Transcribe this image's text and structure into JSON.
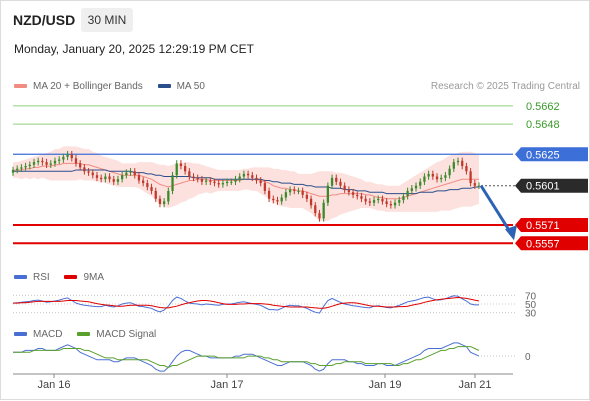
{
  "header": {
    "pair": "NZD/USD",
    "timeframe": "30 MIN",
    "datetime": "Monday, January 20, 2025 12:29:19 PM CET"
  },
  "legend": {
    "ma20_label": "MA 20 + Bollinger Bands",
    "ma50_label": "MA 50",
    "credit": "Research © 2025 Trading Central",
    "rsi_label": "RSI",
    "rsi_ma_label": "9MA",
    "macd_label": "MACD",
    "macd_signal_label": "MACD Signal"
  },
  "colors": {
    "ma20": "#f28b82",
    "bollinger_fill": "#fbd9d6",
    "ma50": "#2b4f8c",
    "resistance_line": "#8fd07a",
    "resistance_text": "#3a9a2a",
    "pivot_line": "#3c6fd8",
    "support_line": "#e00000",
    "bull_candle": "#3a8a2a",
    "bear_candle": "#c0392b",
    "rsi": "#4a6fd4",
    "rsi_ma": "#e00000",
    "macd": "#4a6fd4",
    "macd_signal": "#5aa02c",
    "arrow": "#2d63b5"
  },
  "chart_data": {
    "type": "candlestick",
    "title": "NZD/USD 30 MIN",
    "x_tick_labels": [
      "Jan 16",
      "Jan 17",
      "Jan 19",
      "Jan 21"
    ],
    "price_range": [
      0.5545,
      0.5668
    ],
    "levels": [
      {
        "value": 0.5662,
        "label": "0.5662",
        "kind": "resistance"
      },
      {
        "value": 0.5648,
        "label": "0.5648",
        "kind": "resistance"
      },
      {
        "value": 0.5625,
        "label": "0.5625",
        "kind": "pivot"
      },
      {
        "value": 0.5601,
        "label": "0.5601",
        "kind": "last"
      },
      {
        "value": 0.5571,
        "label": "0.5571",
        "kind": "support"
      },
      {
        "value": 0.5557,
        "label": "0.5557",
        "kind": "support"
      }
    ],
    "last_price": 0.5601,
    "forecast_target": 0.5557,
    "close_series": [
      0.5613,
      0.5614,
      0.5615,
      0.5616,
      0.5617,
      0.5619,
      0.562,
      0.5619,
      0.5617,
      0.5618,
      0.562,
      0.5621,
      0.5623,
      0.5625,
      0.5622,
      0.5618,
      0.5615,
      0.5612,
      0.5611,
      0.5609,
      0.5607,
      0.5606,
      0.5608,
      0.5606,
      0.5604,
      0.5606,
      0.5609,
      0.5611,
      0.5612,
      0.5609,
      0.5605,
      0.5603,
      0.56,
      0.5597,
      0.5591,
      0.5587,
      0.5589,
      0.5597,
      0.5609,
      0.5618,
      0.5616,
      0.5612,
      0.5608,
      0.5607,
      0.5606,
      0.5604,
      0.5605,
      0.5604,
      0.5603,
      0.5602,
      0.5603,
      0.5604,
      0.5604,
      0.5606,
      0.5608,
      0.561,
      0.5609,
      0.5607,
      0.5605,
      0.5603,
      0.5597,
      0.5591,
      0.559,
      0.5589,
      0.5592,
      0.5596,
      0.5598,
      0.5597,
      0.5597,
      0.5594,
      0.5591,
      0.5586,
      0.558,
      0.5576,
      0.5588,
      0.5601,
      0.5607,
      0.5604,
      0.5601,
      0.5598,
      0.5596,
      0.5594,
      0.5593,
      0.5591,
      0.5589,
      0.5588,
      0.559,
      0.5591,
      0.5589,
      0.5587,
      0.5586,
      0.5588,
      0.559,
      0.5593,
      0.5597,
      0.5599,
      0.5601,
      0.5604,
      0.5608,
      0.561,
      0.5608,
      0.5606,
      0.5607,
      0.5609,
      0.5614,
      0.5619,
      0.562,
      0.5616,
      0.5612,
      0.5603,
      0.5601,
      0.5601
    ],
    "ma20_series": [
      0.5613,
      0.5613,
      0.5613,
      0.5614,
      0.5614,
      0.5615,
      0.5615,
      0.5616,
      0.5616,
      0.5616,
      0.5617,
      0.5617,
      0.5618,
      0.5618,
      0.5618,
      0.5618,
      0.5618,
      0.5617,
      0.5617,
      0.5616,
      0.5615,
      0.5614,
      0.5613,
      0.5612,
      0.5611,
      0.561,
      0.5609,
      0.5609,
      0.5609,
      0.5609,
      0.5609,
      0.5608,
      0.5607,
      0.5606,
      0.5604,
      0.5602,
      0.5601,
      0.56,
      0.5601,
      0.5602,
      0.5603,
      0.5604,
      0.5605,
      0.5605,
      0.5606,
      0.5606,
      0.5606,
      0.5605,
      0.5605,
      0.5605,
      0.5605,
      0.5605,
      0.5605,
      0.5605,
      0.5605,
      0.5606,
      0.5606,
      0.5606,
      0.5606,
      0.5605,
      0.5604,
      0.5603,
      0.5601,
      0.56,
      0.5599,
      0.5599,
      0.5598,
      0.5598,
      0.5597,
      0.5597,
      0.5596,
      0.5595,
      0.5594,
      0.5593,
      0.5593,
      0.5593,
      0.5594,
      0.5594,
      0.5595,
      0.5595,
      0.5595,
      0.5595,
      0.5595,
      0.5595,
      0.5594,
      0.5594,
      0.5593,
      0.5592,
      0.5592,
      0.5591,
      0.5591,
      0.5591,
      0.5591,
      0.5592,
      0.5593,
      0.5594,
      0.5595,
      0.5596,
      0.5597,
      0.5598,
      0.5599,
      0.56,
      0.5601,
      0.5602,
      0.5603,
      0.5604,
      0.5605,
      0.5606,
      0.5606,
      0.5606,
      0.5606,
      0.5606
    ],
    "band_half_width": [
      0.0006,
      0.0006,
      0.0007,
      0.0007,
      0.0008,
      0.0008,
      0.0009,
      0.0009,
      0.001,
      0.0011,
      0.0012,
      0.0012,
      0.0013,
      0.0013,
      0.0013,
      0.0013,
      0.0012,
      0.0012,
      0.0012,
      0.0011,
      0.0011,
      0.001,
      0.001,
      0.001,
      0.001,
      0.001,
      0.0009,
      0.0009,
      0.0009,
      0.0009,
      0.001,
      0.0011,
      0.0012,
      0.0013,
      0.0014,
      0.0015,
      0.0016,
      0.0016,
      0.0016,
      0.0016,
      0.0015,
      0.0015,
      0.0014,
      0.0013,
      0.0012,
      0.0011,
      0.001,
      0.001,
      0.0009,
      0.0008,
      0.0008,
      0.0008,
      0.0008,
      0.0008,
      0.0008,
      0.0008,
      0.0008,
      0.0009,
      0.0009,
      0.001,
      0.0011,
      0.0012,
      0.0013,
      0.0014,
      0.0014,
      0.0014,
      0.0014,
      0.0014,
      0.0013,
      0.0013,
      0.0014,
      0.0015,
      0.0017,
      0.0019,
      0.0019,
      0.0019,
      0.0018,
      0.0017,
      0.0016,
      0.0015,
      0.0014,
      0.0013,
      0.0012,
      0.0011,
      0.001,
      0.001,
      0.001,
      0.001,
      0.001,
      0.001,
      0.001,
      0.001,
      0.001,
      0.0011,
      0.0012,
      0.0013,
      0.0014,
      0.0015,
      0.0016,
      0.0017,
      0.0018,
      0.0019,
      0.0019,
      0.002,
      0.0021,
      0.0021,
      0.0021,
      0.0021,
      0.0021,
      0.0021,
      0.002,
      0.0019
    ],
    "ma50_series": [
      0.5612,
      0.5612,
      0.5612,
      0.5612,
      0.5612,
      0.5612,
      0.5612,
      0.5612,
      0.5612,
      0.5612,
      0.5612,
      0.5612,
      0.5612,
      0.5612,
      0.5612,
      0.5613,
      0.5613,
      0.5613,
      0.5613,
      0.5613,
      0.5613,
      0.5613,
      0.5613,
      0.5612,
      0.5612,
      0.5612,
      0.5612,
      0.5612,
      0.5612,
      0.5611,
      0.5611,
      0.5611,
      0.561,
      0.561,
      0.5609,
      0.5609,
      0.5608,
      0.5608,
      0.5608,
      0.5608,
      0.5608,
      0.5608,
      0.5608,
      0.5607,
      0.5607,
      0.5607,
      0.5607,
      0.5607,
      0.5606,
      0.5606,
      0.5606,
      0.5606,
      0.5606,
      0.5606,
      0.5606,
      0.5606,
      0.5606,
      0.5606,
      0.5606,
      0.5606,
      0.5605,
      0.5605,
      0.5604,
      0.5604,
      0.5603,
      0.5603,
      0.5603,
      0.5602,
      0.5602,
      0.5602,
      0.5601,
      0.5601,
      0.56,
      0.56,
      0.56,
      0.56,
      0.5599,
      0.5599,
      0.5599,
      0.5598,
      0.5598,
      0.5598,
      0.5597,
      0.5597,
      0.5597,
      0.5596,
      0.5596,
      0.5596,
      0.5596,
      0.5595,
      0.5595,
      0.5595,
      0.5595,
      0.5595,
      0.5595,
      0.5595,
      0.5595,
      0.5596,
      0.5596,
      0.5596,
      0.5596,
      0.5597,
      0.5597,
      0.5597,
      0.5598,
      0.5598,
      0.5598,
      0.5599,
      0.5599,
      0.5599,
      0.56,
      0.56
    ],
    "rsi": {
      "ticks": [
        70,
        50,
        30
      ],
      "range": [
        20,
        80
      ],
      "values": [
        52,
        53,
        54,
        55,
        56,
        58,
        59,
        57,
        54,
        55,
        57,
        59,
        62,
        64,
        58,
        52,
        49,
        47,
        46,
        45,
        44,
        44,
        47,
        45,
        43,
        46,
        50,
        52,
        53,
        49,
        45,
        44,
        42,
        40,
        35,
        32,
        36,
        45,
        58,
        66,
        63,
        57,
        52,
        51,
        50,
        48,
        50,
        49,
        48,
        47,
        49,
        50,
        50,
        52,
        54,
        55,
        53,
        51,
        49,
        47,
        42,
        37,
        37,
        36,
        40,
        45,
        47,
        46,
        46,
        43,
        40,
        35,
        31,
        29,
        45,
        58,
        63,
        58,
        54,
        50,
        48,
        46,
        45,
        43,
        42,
        41,
        45,
        46,
        44,
        42,
        41,
        44,
        47,
        51,
        55,
        57,
        59,
        62,
        65,
        66,
        62,
        59,
        60,
        62,
        66,
        69,
        68,
        62,
        57,
        50,
        48,
        48
      ],
      "ma_values": [
        52,
        52,
        53,
        53,
        54,
        55,
        56,
        56,
        56,
        56,
        56,
        56,
        57,
        58,
        58,
        58,
        57,
        56,
        55,
        53,
        51,
        49,
        48,
        47,
        46,
        45,
        45,
        46,
        47,
        47,
        47,
        47,
        47,
        46,
        44,
        42,
        41,
        41,
        43,
        45,
        48,
        51,
        53,
        55,
        57,
        58,
        58,
        57,
        55,
        53,
        51,
        49,
        49,
        49,
        50,
        50,
        51,
        51,
        51,
        51,
        50,
        49,
        47,
        46,
        45,
        44,
        43,
        43,
        43,
        43,
        43,
        42,
        41,
        40,
        40,
        42,
        45,
        48,
        51,
        52,
        53,
        53,
        52,
        50,
        48,
        46,
        45,
        45,
        44,
        43,
        43,
        43,
        44,
        44,
        45,
        47,
        49,
        51,
        54,
        56,
        58,
        60,
        61,
        62,
        63,
        64,
        65,
        64,
        63,
        61,
        59,
        57
      ]
    },
    "macd": {
      "ticks": [
        0
      ],
      "range": [
        -0.0009,
        0.0008
      ],
      "macd_values": [
        0.0002,
        0.0002,
        0.0002,
        0.0003,
        0.0003,
        0.0003,
        0.0004,
        0.0004,
        0.0003,
        0.0003,
        0.0003,
        0.0004,
        0.0005,
        0.0006,
        0.0005,
        0.0004,
        0.0002,
        0.0001,
        0.0,
        -0.0001,
        -0.0002,
        -0.0002,
        -0.0002,
        -0.0002,
        -0.0003,
        -0.0003,
        -0.0002,
        -0.0001,
        -0.0001,
        -0.0001,
        -0.0002,
        -0.0003,
        -0.0004,
        -0.0005,
        -0.0007,
        -0.0008,
        -0.0008,
        -0.0006,
        -0.0003,
        0.0,
        0.0002,
        0.0003,
        0.0003,
        0.0002,
        0.0001,
        0.0,
        0.0,
        -0.0001,
        -0.0001,
        -0.0001,
        -0.0001,
        -0.0001,
        -0.0001,
        0.0,
        0.0,
        0.0001,
        0.0001,
        0.0001,
        0.0,
        -0.0001,
        -0.0002,
        -0.0003,
        -0.0004,
        -0.0005,
        -0.0005,
        -0.0004,
        -0.0003,
        -0.0003,
        -0.0003,
        -0.0003,
        -0.0004,
        -0.0005,
        -0.0007,
        -0.0008,
        -0.0007,
        -0.0004,
        -0.0002,
        -0.0002,
        -0.0002,
        -0.0002,
        -0.0003,
        -0.0003,
        -0.0004,
        -0.0004,
        -0.0005,
        -0.0005,
        -0.0005,
        -0.0004,
        -0.0004,
        -0.0005,
        -0.0005,
        -0.0005,
        -0.0004,
        -0.0003,
        -0.0002,
        -0.0001,
        0.0,
        0.0001,
        0.0003,
        0.0004,
        0.0004,
        0.0004,
        0.0004,
        0.0005,
        0.0006,
        0.0007,
        0.0007,
        0.0006,
        0.0005,
        0.0002,
        0.0001,
        0.0
      ],
      "signal_values": [
        0.0002,
        0.0002,
        0.0002,
        0.0002,
        0.0002,
        0.0003,
        0.0003,
        0.0003,
        0.0003,
        0.0003,
        0.0003,
        0.0003,
        0.0004,
        0.0004,
        0.0004,
        0.0004,
        0.0004,
        0.0003,
        0.0003,
        0.0002,
        0.0001,
        0.0,
        -0.0001,
        -0.0001,
        -0.0001,
        -0.0002,
        -0.0002,
        -0.0002,
        -0.0002,
        -0.0002,
        -0.0002,
        -0.0002,
        -0.0002,
        -0.0003,
        -0.0004,
        -0.0005,
        -0.0005,
        -0.0006,
        -0.0005,
        -0.0005,
        -0.0004,
        -0.0003,
        -0.0002,
        -0.0001,
        0.0,
        0.0,
        0.0,
        0.0,
        0.0,
        -0.0001,
        -0.0001,
        -0.0001,
        -0.0001,
        -0.0001,
        -0.0001,
        -0.0001,
        0.0,
        0.0,
        0.0,
        0.0,
        -0.0001,
        -0.0001,
        -0.0002,
        -0.0002,
        -0.0003,
        -0.0003,
        -0.0003,
        -0.0003,
        -0.0003,
        -0.0003,
        -0.0003,
        -0.0004,
        -0.0004,
        -0.0005,
        -0.0005,
        -0.0005,
        -0.0005,
        -0.0004,
        -0.0004,
        -0.0003,
        -0.0003,
        -0.0003,
        -0.0003,
        -0.0003,
        -0.0004,
        -0.0004,
        -0.0004,
        -0.0004,
        -0.0004,
        -0.0004,
        -0.0004,
        -0.0005,
        -0.0005,
        -0.0004,
        -0.0004,
        -0.0003,
        -0.0002,
        -0.0002,
        -0.0001,
        0.0,
        0.0001,
        0.0002,
        0.0003,
        0.0003,
        0.0004,
        0.0004,
        0.0005,
        0.0005,
        0.0005,
        0.0005,
        0.0004,
        0.0003
      ]
    }
  }
}
